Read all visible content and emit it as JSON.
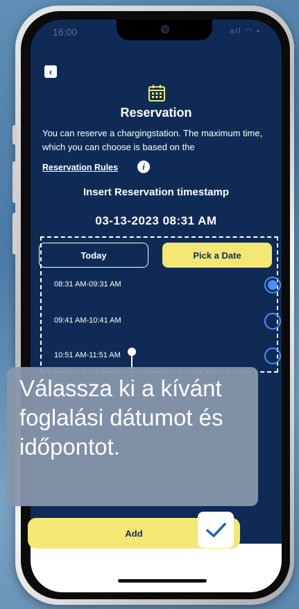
{
  "status_bar": {
    "time": "16:00",
    "icons": "all ◠ ▪"
  },
  "header": {
    "title": "Reservation",
    "description": "You can reserve a chargingstation. The maximum time, which you can choose is based on the",
    "rules_link": "Reservation Rules",
    "info_icon_glyph": "i"
  },
  "reservation": {
    "subtitle": "Insert Reservation timestamp",
    "selected_datetime": "03-13-2023 08:31 AM",
    "buttons": {
      "today": "Today",
      "pick_date": "Pick a Date"
    },
    "slots": [
      {
        "label": "08:31 AM-09:31 AM",
        "selected": true
      },
      {
        "label": "09:41 AM-10:41 AM",
        "selected": false
      },
      {
        "label": "10:51 AM-11:51 AM",
        "selected": false
      }
    ]
  },
  "tooltip": {
    "text": "Válassza ki a kívánt foglalási dátumot és időpontot."
  },
  "footer": {
    "add_label": "Add"
  },
  "colors": {
    "screen_bg": "#0f2b55",
    "accent_yellow": "#f2e873",
    "radio_blue": "#4f8ef7",
    "tooltip_bg": "#8796ac"
  },
  "icons": {
    "back": "chevron-left-icon",
    "calendar": "calendar-icon",
    "info": "info-icon",
    "check": "checkmark-icon"
  }
}
